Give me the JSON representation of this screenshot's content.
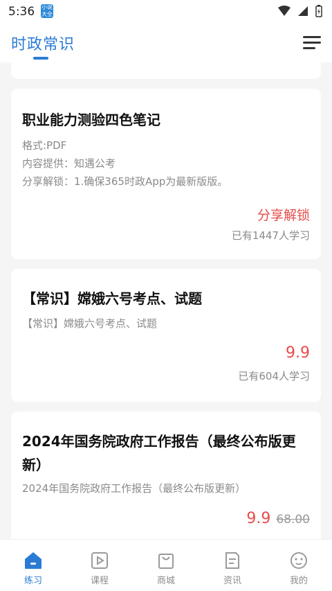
{
  "status": {
    "time": "5:36",
    "app_icon_text": "小说\n大全"
  },
  "header": {
    "title": "时政常识"
  },
  "cards": [
    {
      "title": "职业能力测验四色笔记",
      "meta": [
        "格式:PDF",
        "内容提供：知遇公考",
        "分享解锁：1.确保365时政App为最新版版。"
      ],
      "cta": "分享解锁",
      "learners": "已有1447人学习"
    },
    {
      "title": "【常识】嫦娥六号考点、试题",
      "subtitle": "【常识】嫦娥六号考点、试题",
      "price": "9.9",
      "learners": "已有604人学习"
    },
    {
      "title": "2024年国务院政府工作报告（最终公布版更新）",
      "subtitle": "2024年国务院政府工作报告（最终公布版更新）",
      "price": "9.9",
      "old_price": "68.00"
    }
  ],
  "tabs": [
    {
      "label": "练习",
      "icon": "practice-icon"
    },
    {
      "label": "课程",
      "icon": "course-icon"
    },
    {
      "label": "商城",
      "icon": "shop-icon"
    },
    {
      "label": "资讯",
      "icon": "news-icon"
    },
    {
      "label": "我的",
      "icon": "profile-icon"
    }
  ],
  "colors": {
    "accent": "#2a7bd5",
    "price": "#e84b4b"
  }
}
